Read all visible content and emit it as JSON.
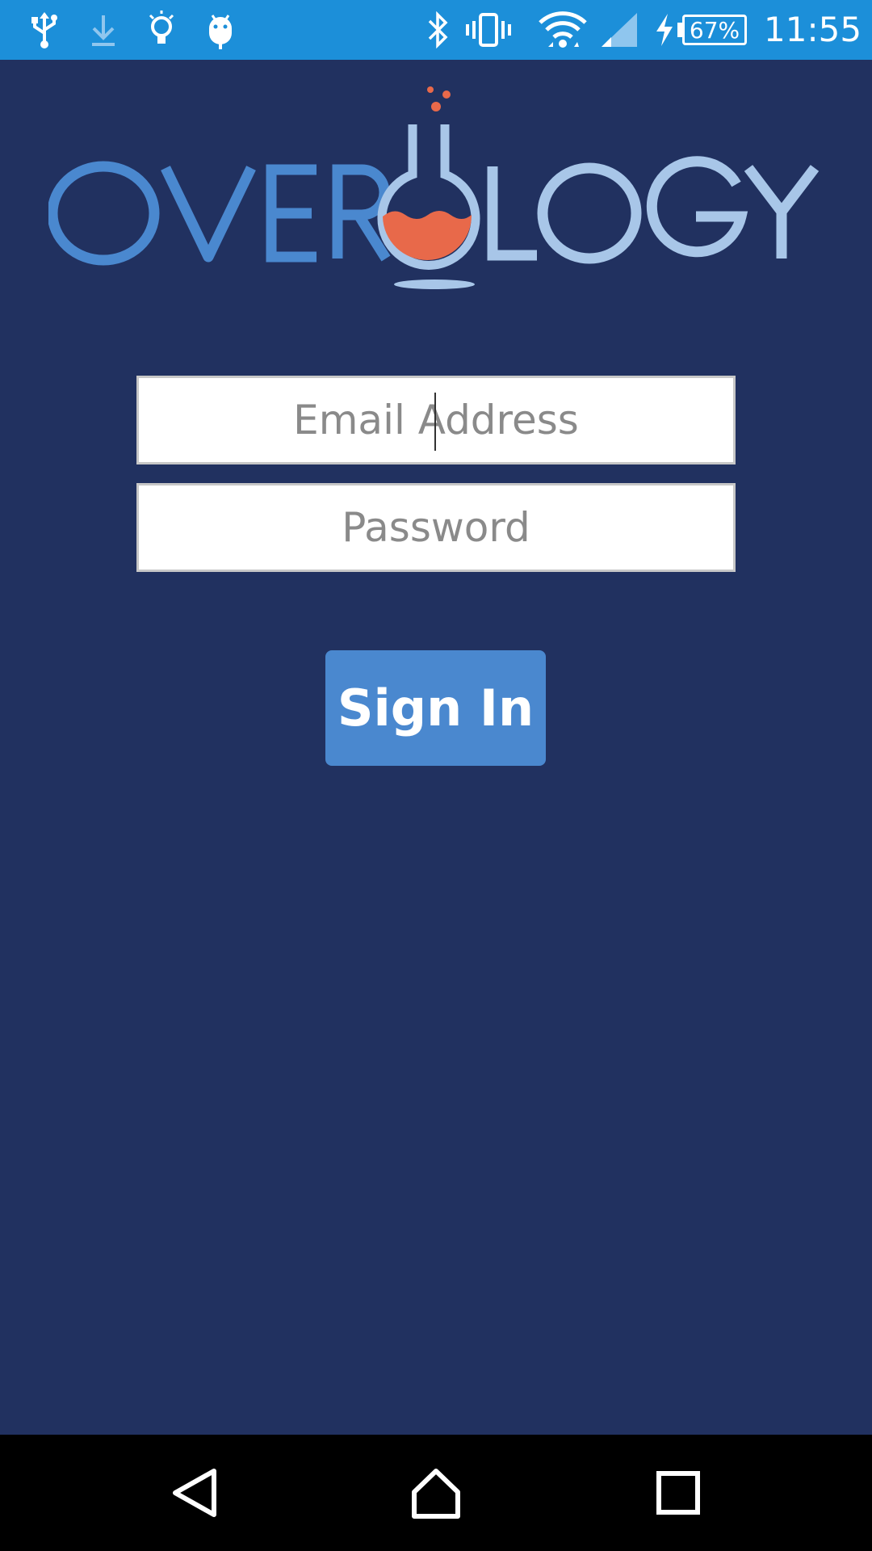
{
  "status_bar": {
    "battery": "67%",
    "time": "11:55",
    "icons": [
      "usb-icon",
      "download-icon",
      "lightbulb-icon",
      "android-icon",
      "bluetooth-icon",
      "vibrate-icon",
      "wifi-icon",
      "signal-icon",
      "charging-icon",
      "battery-icon"
    ]
  },
  "login": {
    "email_placeholder": "Email Address",
    "password_placeholder": "Password",
    "sign_in_label": "Sign In"
  },
  "nav_bar": {
    "icons": [
      "back-icon",
      "home-icon",
      "recents-icon"
    ]
  },
  "colors": {
    "background": "#213160",
    "status_bar": "#1c8fd9",
    "button": "#4a88cf",
    "logo_blue": "#4a88cf",
    "logo_light": "#a8c6e8",
    "logo_orange": "#e8694a"
  }
}
